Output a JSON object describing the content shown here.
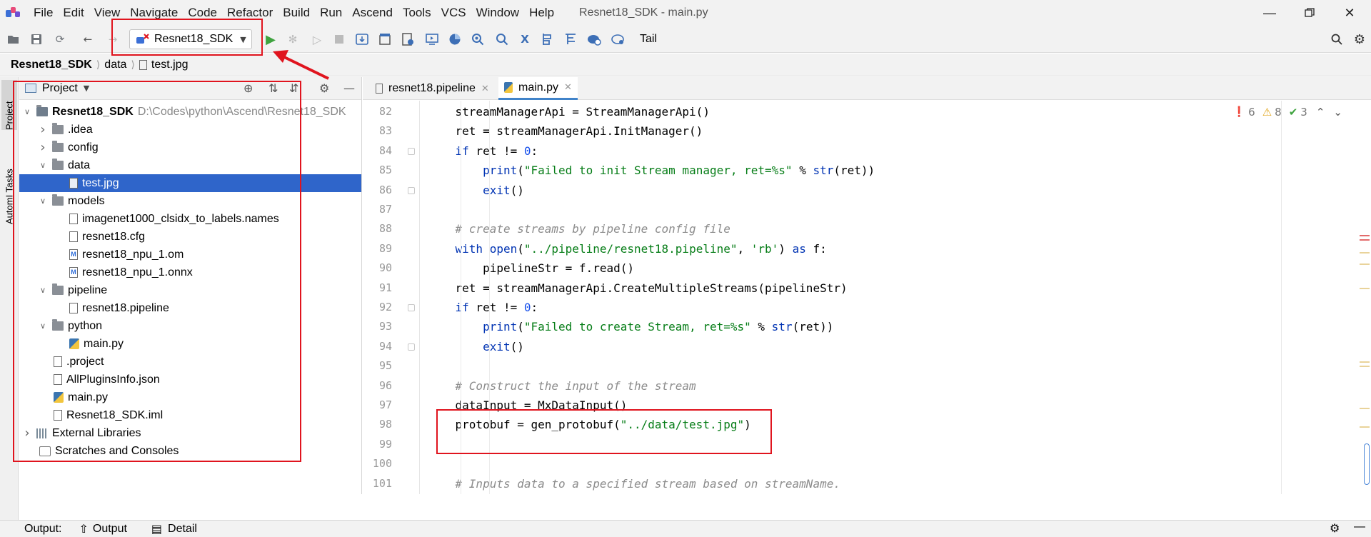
{
  "menu": {
    "items": [
      "File",
      "Edit",
      "View",
      "Navigate",
      "Code",
      "Refactor",
      "Build",
      "Run",
      "Ascend",
      "Tools",
      "VCS",
      "Window",
      "Help"
    ],
    "window_title": "Resnet18_SDK - main.py"
  },
  "toolbar": {
    "run_config": "Resnet18_SDK",
    "tail_label": "Tail"
  },
  "breadcrumb": [
    "Resnet18_SDK",
    "data",
    "test.jpg"
  ],
  "left_stripe": [
    "Project",
    "AutomI Tasks"
  ],
  "project_panel": {
    "title": "Project",
    "tree": [
      {
        "label": "Resnet18_SDK",
        "hint": "D:\\Codes\\python\\Ascend\\Resnet18_SDK",
        "type": "module",
        "depth": 0,
        "expanded": true
      },
      {
        "label": ".idea",
        "type": "folder",
        "depth": 1,
        "expanded": false
      },
      {
        "label": "config",
        "type": "folder",
        "depth": 1,
        "expanded": false
      },
      {
        "label": "data",
        "type": "folder",
        "depth": 1,
        "expanded": true
      },
      {
        "label": "test.jpg",
        "type": "image",
        "depth": 2,
        "selected": true
      },
      {
        "label": "models",
        "type": "folder",
        "depth": 1,
        "expanded": true
      },
      {
        "label": "imagenet1000_clsidx_to_labels.names",
        "type": "file",
        "depth": 2
      },
      {
        "label": "resnet18.cfg",
        "type": "file",
        "depth": 2
      },
      {
        "label": "resnet18_npu_1.om",
        "type": "model",
        "depth": 2
      },
      {
        "label": "resnet18_npu_1.onnx",
        "type": "model",
        "depth": 2
      },
      {
        "label": "pipeline",
        "type": "folder",
        "depth": 1,
        "expanded": true
      },
      {
        "label": "resnet18.pipeline",
        "type": "file",
        "depth": 2
      },
      {
        "label": "python",
        "type": "folder",
        "depth": 1,
        "expanded": true
      },
      {
        "label": "main.py",
        "type": "python",
        "depth": 2
      },
      {
        "label": ".project",
        "type": "file",
        "depth": 1
      },
      {
        "label": "AllPluginsInfo.json",
        "type": "file",
        "depth": 1
      },
      {
        "label": "main.py",
        "type": "python",
        "depth": 1
      },
      {
        "label": "Resnet18_SDK.iml",
        "type": "file",
        "depth": 1
      },
      {
        "label": "External Libraries",
        "type": "library",
        "depth": 0,
        "expanded": false
      },
      {
        "label": "Scratches and Consoles",
        "type": "scratch",
        "depth": 0
      }
    ]
  },
  "editor": {
    "tabs": [
      {
        "label": "resnet18.pipeline",
        "active": false
      },
      {
        "label": "main.py",
        "active": true
      }
    ],
    "inspections": {
      "errors": "6",
      "warnings": "8",
      "ok": "3"
    },
    "lines": [
      {
        "no": "82",
        "code": "    streamManagerApi = StreamManagerApi()"
      },
      {
        "no": "83",
        "code": "    ret = streamManagerApi.InitManager()"
      },
      {
        "no": "84",
        "code": "    if ret != 0:"
      },
      {
        "no": "85",
        "code": "        print(\"Failed to init Stream manager, ret=%s\" % str(ret))"
      },
      {
        "no": "86",
        "code": "        exit()"
      },
      {
        "no": "87",
        "code": ""
      },
      {
        "no": "88",
        "code": "    # create streams by pipeline config file"
      },
      {
        "no": "89",
        "code": "    with open(\"../pipeline/resnet18.pipeline\", 'rb') as f:"
      },
      {
        "no": "90",
        "code": "        pipelineStr = f.read()"
      },
      {
        "no": "91",
        "code": "    ret = streamManagerApi.CreateMultipleStreams(pipelineStr)"
      },
      {
        "no": "92",
        "code": "    if ret != 0:"
      },
      {
        "no": "93",
        "code": "        print(\"Failed to create Stream, ret=%s\" % str(ret))"
      },
      {
        "no": "94",
        "code": "        exit()"
      },
      {
        "no": "95",
        "code": ""
      },
      {
        "no": "96",
        "code": "    # Construct the input of the stream"
      },
      {
        "no": "97",
        "code": "    dataInput = MxDataInput()"
      },
      {
        "no": "98",
        "code": "    protobuf = gen_protobuf(\"../data/test.jpg\")"
      },
      {
        "no": "99",
        "code": ""
      },
      {
        "no": "100",
        "code": ""
      },
      {
        "no": "101",
        "code": "    # Inputs data to a specified stream based on streamName."
      }
    ]
  },
  "output_bar": {
    "label": "Output:",
    "tab_output": "Output",
    "tab_detail": "Detail"
  },
  "colors": {
    "annotation_red": "#e0141e",
    "selection_blue": "#2f65ca",
    "keyword": "#0033b3",
    "string": "#067d17",
    "comment": "#8c8c8c",
    "run_green": "#3fa33f"
  }
}
